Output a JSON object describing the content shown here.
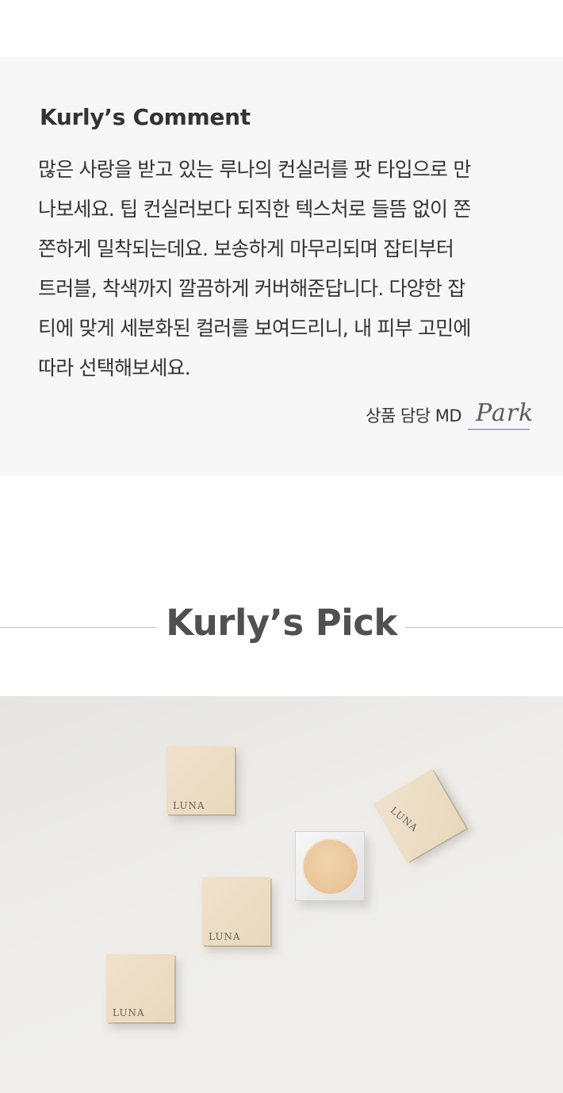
{
  "comment": {
    "title": "Kurly’s Comment",
    "lines": [
      "많은 사랑을 받고 있는 루나의 컨실러를 팟 타입으로 만",
      "나보세요. 팁 컨실러보다 되직한 텍스처로 들뜸 없이 쫀",
      "쫀하게 밀착되는데요. 보송하게 마무리되며 잡티부터",
      "트러블, 착색까지 깔끔하게 커버해준답니다. 다양한 잡",
      "티에 맞게 세분화된 컬러를 보여드리니, 내 피부 고민에",
      "따라 선택해보세요."
    ],
    "md_label": "상품 담당 MD",
    "md_signature": "Park"
  },
  "pick": {
    "title": "Kurly’s Pick"
  },
  "product_photo": {
    "brand_text": "LUNA",
    "signature_underline_color": "#b99ed6"
  }
}
